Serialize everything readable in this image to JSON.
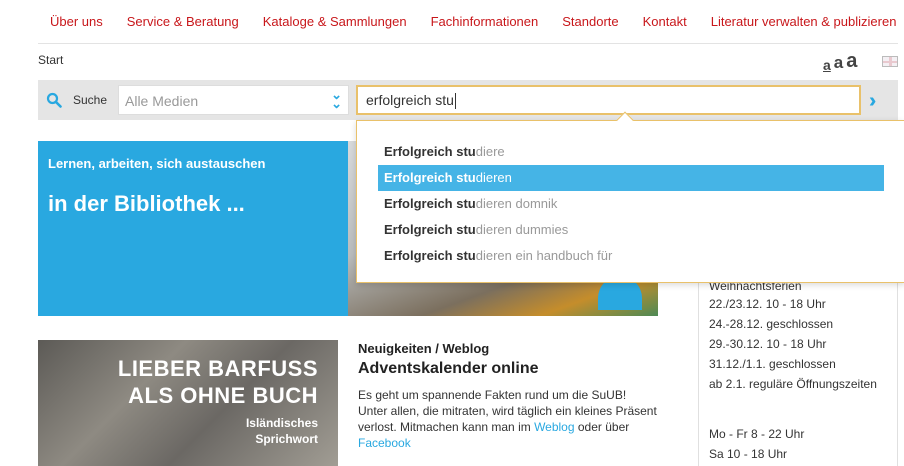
{
  "nav": [
    "Über uns",
    "Service & Beratung",
    "Kataloge & Sammlungen",
    "Fachinformationen",
    "Standorte",
    "Kontakt",
    "Literatur verwalten & publizieren"
  ],
  "breadcrumb": "Start",
  "fontsize": {
    "small": "a",
    "medium": "a",
    "large": "a"
  },
  "search": {
    "label": "Suche",
    "scope": "Alle Medien",
    "query": "erfolgreich stu"
  },
  "suggestions": [
    {
      "bold": "Erfolgreich stu",
      "rest": "diere"
    },
    {
      "bold": "Erfolgreich stu",
      "rest": "dieren"
    },
    {
      "bold": "Erfolgreich stu",
      "rest": "dieren domnik"
    },
    {
      "bold": "Erfolgreich stu",
      "rest": "dieren dummies"
    },
    {
      "bold": "Erfolgreich stu",
      "rest": "dieren ein handbuch für"
    }
  ],
  "hero": {
    "subtitle": "Lernen, arbeiten, sich austauschen",
    "title": "in der Bibliothek ..."
  },
  "hours": {
    "heading": "Weihnachtsferien",
    "lines": [
      "22./23.12. 10 - 18 Uhr",
      "24.-28.12. geschlossen",
      "29.-30.12. 10 - 18 Uhr",
      "31.12./1.1. geschlossen",
      "ab 2.1. reguläre Öffnungszeiten"
    ],
    "regular": [
      "Mo - Fr 8 - 22 Uhr",
      "Sa 10 - 18 Uhr"
    ]
  },
  "quote": {
    "line1": "LIEBER BARFUSS",
    "line2": "ALS OHNE BUCH",
    "line3": "Isländisches",
    "line4": "Sprichwort"
  },
  "news": {
    "category": "Neuigkeiten / Weblog",
    "title": "Adventskalender online",
    "body1": "Es geht um spannende Fakten rund um die SuUB! Unter allen, die mitraten, wird täglich ein kleines Präsent verlost. Mitmachen kann man im ",
    "link1": "Weblog",
    "body2": " oder über ",
    "link2": "Facebook"
  },
  "colors": {
    "nav": "#c8171b",
    "accent": "#29a8e0",
    "highlight": "#45b4e6",
    "border": "#e9c16a"
  }
}
